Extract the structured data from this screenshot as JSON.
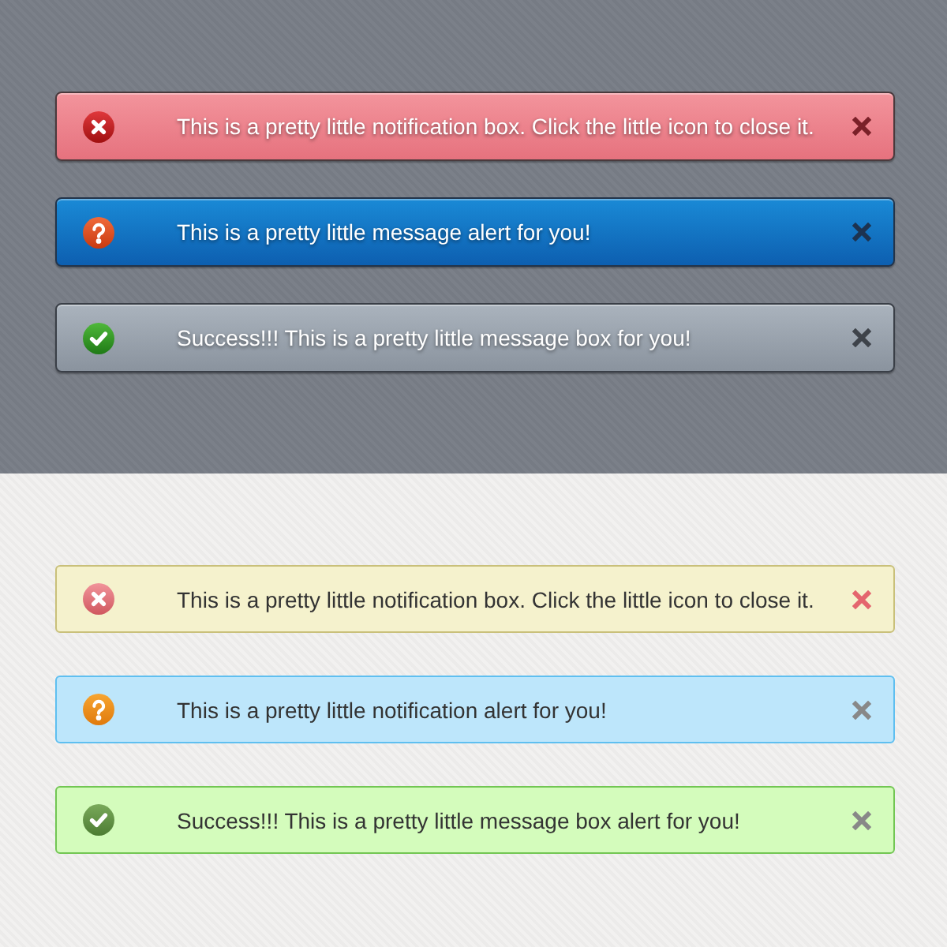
{
  "sections": [
    {
      "kind": "dark",
      "alerts": [
        {
          "kind": "error",
          "text": "This is a pretty little notification box. Click the little icon to close it."
        },
        {
          "kind": "info",
          "text": "This is a pretty little message alert for you!"
        },
        {
          "kind": "success",
          "text": "Success!!! This is a pretty little message box for you!"
        }
      ]
    },
    {
      "kind": "light",
      "alerts": [
        {
          "kind": "error",
          "text": "This is a pretty little notification box. Click the little icon to close it."
        },
        {
          "kind": "info",
          "text": "This is a pretty little notification alert for you!"
        },
        {
          "kind": "success",
          "text": "Success!!! This is a pretty little message box alert for you!"
        }
      ]
    }
  ]
}
